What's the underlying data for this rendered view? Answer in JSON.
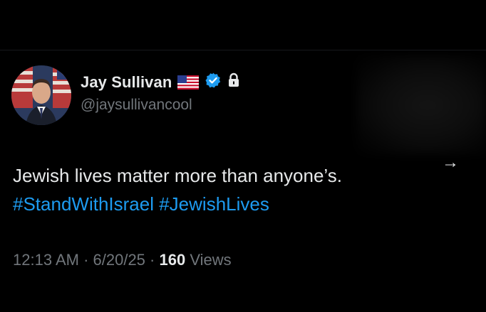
{
  "author": {
    "display_name": "Jay Sullivan",
    "handle": "@jaysullivancool",
    "flag_icon": "us-flag-icon",
    "verified_icon": "verified-badge-icon",
    "lock_icon": "lock-icon",
    "verified_color": "#1d9bf0"
  },
  "tweet": {
    "text": "Jewish lives matter more than anyone’s.",
    "hashtags": [
      "#StandWithIsrael",
      "#JewishLives"
    ],
    "hashtag_color": "#1d9bf0"
  },
  "meta": {
    "time": "12:13 AM",
    "separator": " · ",
    "date": "6/20/25",
    "views_count": "160",
    "views_label": " Views"
  },
  "actions": {
    "arrow": "→"
  }
}
